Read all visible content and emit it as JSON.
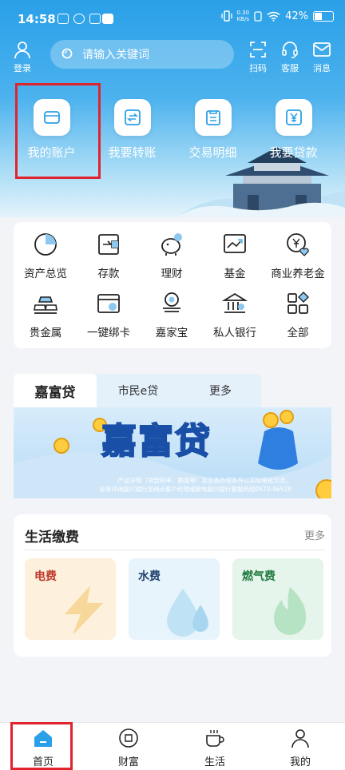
{
  "status": {
    "time": "14:58",
    "net_rate": "0.30",
    "net_unit": "KB/s",
    "battery": "42%"
  },
  "header": {
    "login_label": "登录",
    "search_placeholder": "请输入关键词",
    "scan_label": "扫码",
    "service_label": "客服",
    "message_label": "消息"
  },
  "quick_actions": [
    {
      "label": "我的账户",
      "icon": "card-icon"
    },
    {
      "label": "我要转账",
      "icon": "transfer-icon"
    },
    {
      "label": "交易明细",
      "icon": "receipt-icon"
    },
    {
      "label": "我要贷款",
      "icon": "yen-icon"
    }
  ],
  "grid": [
    {
      "label": "资产总览",
      "icon": "pie-chart-icon"
    },
    {
      "label": "存款",
      "icon": "deposit-icon"
    },
    {
      "label": "理财",
      "icon": "piggy-bank-icon"
    },
    {
      "label": "基金",
      "icon": "fund-chart-icon"
    },
    {
      "label": "商业养老金",
      "icon": "pension-heart-icon"
    },
    {
      "label": "贵金属",
      "icon": "gold-bars-icon"
    },
    {
      "label": "一键绑卡",
      "icon": "bind-card-icon"
    },
    {
      "label": "嘉家宝",
      "icon": "coin-stack-icon"
    },
    {
      "label": "私人银行",
      "icon": "bank-building-icon"
    },
    {
      "label": "全部",
      "icon": "all-apps-icon"
    }
  ],
  "loan": {
    "tabs": [
      "嘉富贷",
      "市民e贷",
      "更多"
    ],
    "banner_title": "嘉富贷",
    "banner_note1": "产品详情（贷款利率、额度等）及业务办理条件以实际审批为准。",
    "banner_note2": "业务详询嘉兴银行各网点客户经理或致电嘉兴银行客服热线0573-96528"
  },
  "life": {
    "title": "生活缴费",
    "more": "更多",
    "cards": [
      {
        "label": "电费",
        "color": "#c0392b",
        "bg": "#fdf0dc"
      },
      {
        "label": "水费",
        "color": "#1d3f6e",
        "bg": "#e8f4fb"
      },
      {
        "label": "燃气费",
        "color": "#1f7a3f",
        "bg": "#e6f5eb"
      }
    ]
  },
  "nav": [
    {
      "label": "首页"
    },
    {
      "label": "财富"
    },
    {
      "label": "生活"
    },
    {
      "label": "我的"
    }
  ],
  "colors": {
    "primary": "#2aa0e8",
    "highlight": "#e0242e"
  }
}
